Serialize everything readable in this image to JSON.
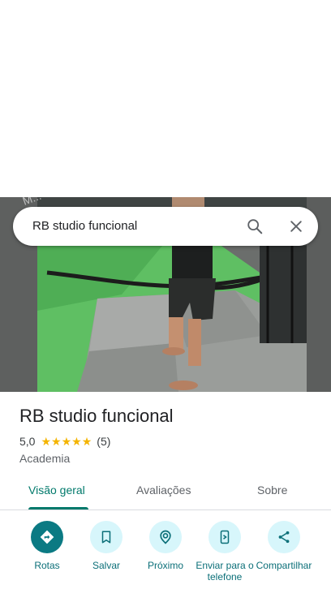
{
  "search": {
    "query": "RB studio funcional"
  },
  "place": {
    "name": "RB studio funcional",
    "rating": "5,0",
    "stars": 5,
    "review_count": "(5)",
    "category": "Academia"
  },
  "tabs": [
    {
      "label": "Visão geral",
      "active": true
    },
    {
      "label": "Avaliações",
      "active": false
    },
    {
      "label": "Sobre",
      "active": false
    }
  ],
  "actions": [
    {
      "label": "Rotas",
      "icon": "directions-icon"
    },
    {
      "label": "Salvar",
      "icon": "bookmark-icon"
    },
    {
      "label": "Próximo",
      "icon": "nearby-icon"
    },
    {
      "label": "Enviar para o telefone",
      "icon": "send-to-phone-icon"
    },
    {
      "label": "Compartilhar",
      "icon": "share-icon"
    }
  ],
  "colors": {
    "accent": "#00796b",
    "action_bg": "#d7f6fb",
    "primary_action": "#0b7a83",
    "star": "#f4b400"
  }
}
